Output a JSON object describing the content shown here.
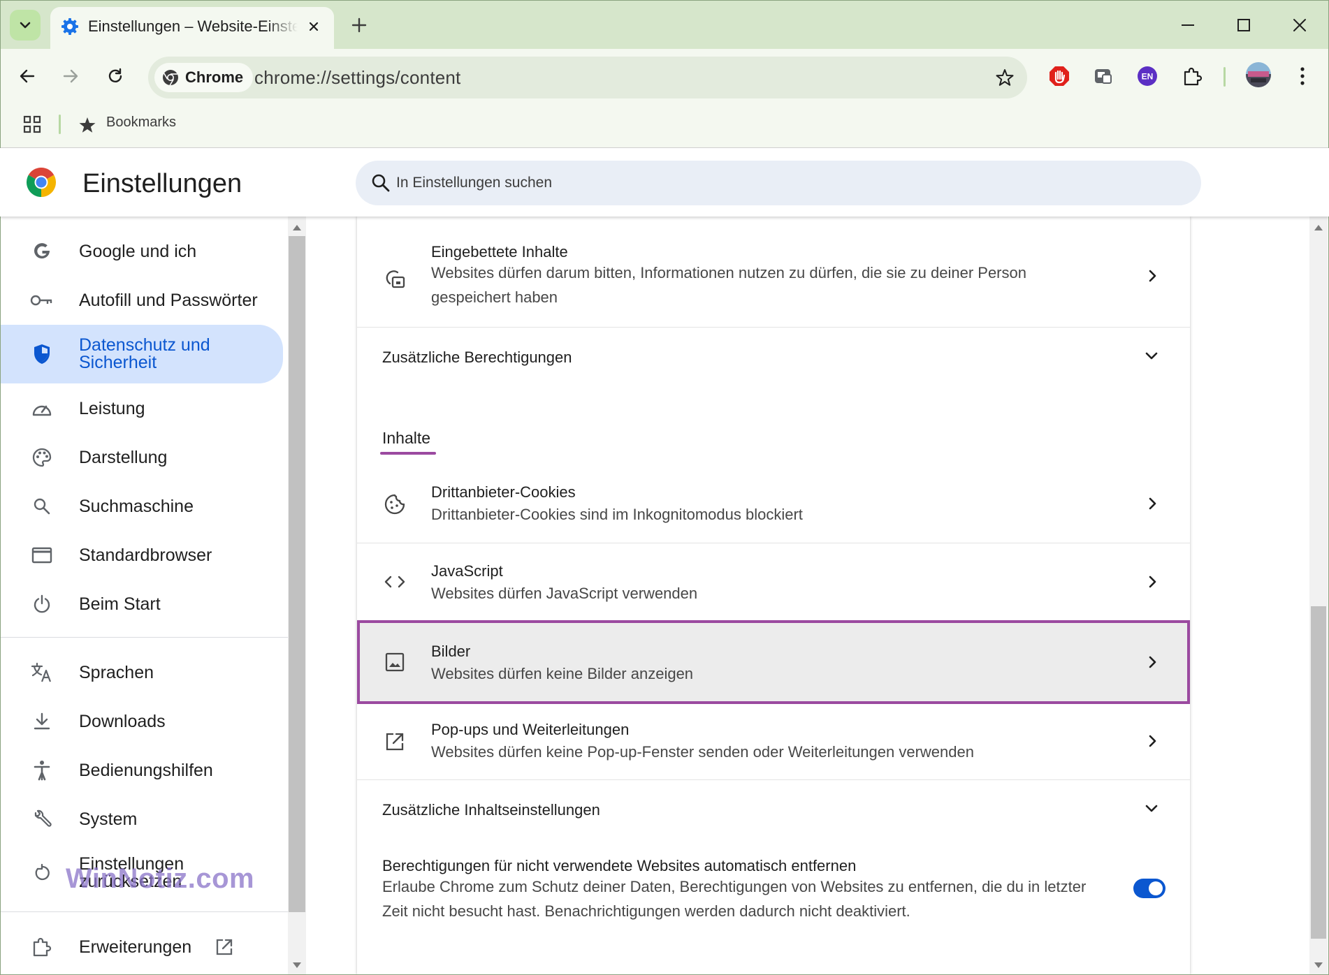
{
  "browser": {
    "tab": {
      "title": "Einstellungen – Website-Einstell",
      "close_icon": "close-icon",
      "favicon": "gear-icon"
    },
    "url_chip": "Chrome",
    "url": "chrome://settings/content",
    "bookmarks_label": "Bookmarks",
    "extensions": [
      "adblock-icon",
      "media-extension-icon",
      "en-language-icon",
      "puzzle-icon"
    ],
    "extension_en_label": "EN",
    "colors": {
      "tabbar": "#d6e6cb",
      "toolbar": "#f4f8f0",
      "accent": "#0b57d0",
      "highlight": "#9b4aa0"
    }
  },
  "header": {
    "title": "Einstellungen",
    "search_placeholder": "In Einstellungen suchen"
  },
  "sidebar": {
    "items": [
      {
        "label": "Google und ich",
        "icon": "google-g-icon"
      },
      {
        "label": "Autofill und Passwörter",
        "icon": "key-icon"
      },
      {
        "label": "Datenschutz und Sicherheit",
        "icon": "shield-icon",
        "active": true
      },
      {
        "label": "Leistung",
        "icon": "speedometer-icon"
      },
      {
        "label": "Darstellung",
        "icon": "palette-icon"
      },
      {
        "label": "Suchmaschine",
        "icon": "search-icon"
      },
      {
        "label": "Standardbrowser",
        "icon": "browser-window-icon"
      },
      {
        "label": "Beim Start",
        "icon": "power-icon"
      },
      {
        "label": "Sprachen",
        "icon": "translate-icon"
      },
      {
        "label": "Downloads",
        "icon": "download-icon"
      },
      {
        "label": "Bedienungshilfen",
        "icon": "accessibility-icon"
      },
      {
        "label": "System",
        "icon": "wrench-icon"
      },
      {
        "label": "Einstellungen zurücksetzen",
        "icon": "reset-icon"
      },
      {
        "label": "Erweiterungen",
        "icon": "puzzle-icon"
      }
    ],
    "watermark": "WinNotiz.com"
  },
  "main": {
    "embedded": {
      "title": "Eingebettete Inhalte",
      "sub1": "Websites dürfen darum bitten, Informationen nutzen zu dürfen, die sie zu deiner Person",
      "sub2": "gespeichert haben"
    },
    "additional_permissions": "Zusätzliche Berechtigungen",
    "content_section": "Inhalte",
    "rows": [
      {
        "title": "Drittanbieter-Cookies",
        "sub": "Drittanbieter-Cookies sind im Inkognitomodus blockiert",
        "icon": "cookie-icon"
      },
      {
        "title": "JavaScript",
        "sub": "Websites dürfen JavaScript verwenden",
        "icon": "code-brackets-icon"
      },
      {
        "title": "Bilder",
        "sub": "Websites dürfen keine Bilder anzeigen",
        "icon": "image-icon",
        "highlighted": true
      },
      {
        "title": "Pop-ups und Weiterleitungen",
        "sub": "Websites dürfen keine Pop-up-Fenster senden oder Weiterleitungen verwenden",
        "icon": "open-external-icon"
      }
    ],
    "additional_content": "Zusätzliche Inhaltseinstellungen",
    "auto_remove": {
      "title": "Berechtigungen für nicht verwendete Websites automatisch entfernen",
      "sub1": "Erlaube Chrome zum Schutz deiner Daten, Berechtigungen von Websites zu entfernen, die du in letzter",
      "sub2": "Zeit nicht besucht hast. Benachrichtigungen werden dadurch nicht deaktiviert.",
      "enabled": true
    }
  }
}
